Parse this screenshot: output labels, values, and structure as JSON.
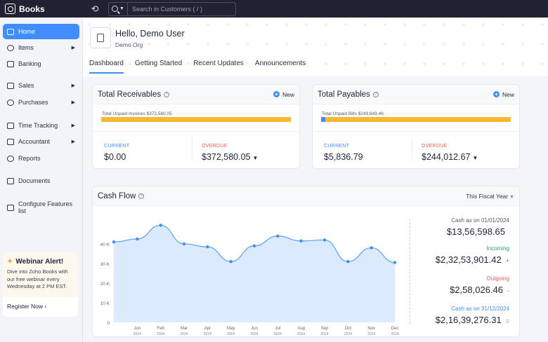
{
  "app": {
    "name": "Books"
  },
  "search": {
    "placeholder": "Search in Customers ( / )"
  },
  "sidebar": {
    "items": [
      {
        "label": "Home",
        "active": true,
        "arrow": false
      },
      {
        "label": "Items",
        "arrow": true
      },
      {
        "label": "Banking",
        "arrow": false
      },
      {
        "label": "Sales",
        "arrow": true
      },
      {
        "label": "Purchases",
        "arrow": true
      },
      {
        "label": "Time Tracking",
        "arrow": true
      },
      {
        "label": "Accountant",
        "arrow": true
      },
      {
        "label": "Reports",
        "arrow": false
      },
      {
        "label": "Documents",
        "arrow": false
      },
      {
        "label": "Configure Features list",
        "arrow": false
      }
    ],
    "arrow_glyph": "▶",
    "webinar": {
      "title": "Webinar Alert!",
      "text": "Dive into Zoho Books with our free webinar every Wednesday at 2 PM EST.",
      "cta": "Register Now ›"
    }
  },
  "header": {
    "greeting": "Hello, Demo User",
    "org": "Demo Org"
  },
  "tabs": [
    {
      "label": "Dashboard",
      "active": true
    },
    {
      "label": "Getting Started"
    },
    {
      "label": "Recent Updates"
    },
    {
      "label": "Announcements"
    }
  ],
  "receivables": {
    "title": "Total Receivables",
    "help": "?",
    "new_label": "New",
    "unpaid": "Total Unpaid Invoices $372,580.05",
    "current_fraction": 0.0,
    "current_label": "CURRENT",
    "current_value": "$0.00",
    "overdue_label": "OVERDUE",
    "overdue_value": "$372,580.05"
  },
  "payables": {
    "title": "Total Payables",
    "help": "?",
    "new_label": "New",
    "unpaid": "Total Unpaid Bills $249,849.46",
    "current_fraction": 0.0234,
    "current_label": "CURRENT",
    "current_value": "$5,836.79",
    "overdue_label": "OVERDUE",
    "overdue_value": "$244,012.67"
  },
  "cashflow": {
    "title": "Cash Flow",
    "help": "?",
    "period": "This Fiscal Year",
    "summary": [
      {
        "label": "Cash as on 01/01/2024",
        "value": "$13,56,598.65",
        "sign": "",
        "color": "#555a6b"
      },
      {
        "label": "Incoming",
        "value": "$2,32,53,901.42",
        "sign": "+",
        "color": "#2e9a5b"
      },
      {
        "label": "Outgoing",
        "value": "$2,58,026.46",
        "sign": "-",
        "color": "#e85c4a"
      },
      {
        "label": "Cash as on 31/12/2024",
        "value": "$2,16,39,276.31",
        "sign": "=",
        "color": "#408dfb"
      }
    ]
  },
  "chart_data": {
    "type": "area",
    "categories": [
      "May",
      "Jun",
      "Feb",
      "Mar",
      "Apr",
      "May",
      "Jun",
      "Jul",
      "Aug",
      "Sep",
      "Oct",
      "Nov",
      "Dec"
    ],
    "category_labels": [
      {
        "month": "Jun",
        "year": "2024"
      },
      {
        "month": "Feb",
        "year": "2024"
      },
      {
        "month": "Mar",
        "year": "2024"
      },
      {
        "month": "Apr",
        "year": "2024"
      },
      {
        "month": "May",
        "year": "2024"
      },
      {
        "month": "Jun",
        "year": "2024"
      },
      {
        "month": "Jul",
        "year": "2024"
      },
      {
        "month": "Aug",
        "year": "2024"
      },
      {
        "month": "Sep",
        "year": "2024"
      },
      {
        "month": "Oct",
        "year": "2024"
      },
      {
        "month": "Nov",
        "year": "2024"
      },
      {
        "month": "Dec",
        "year": "2024"
      }
    ],
    "values": [
      41000,
      42500,
      49500,
      40000,
      38500,
      31000,
      39000,
      44000,
      41500,
      42000,
      31000,
      38000,
      30500
    ],
    "y_ticks": [
      "0",
      "10 K",
      "20 K",
      "30 K",
      "40 K"
    ],
    "ylim": [
      0,
      50000
    ],
    "line_color": "#63a6f6",
    "fill_color": "#dbeafc"
  }
}
